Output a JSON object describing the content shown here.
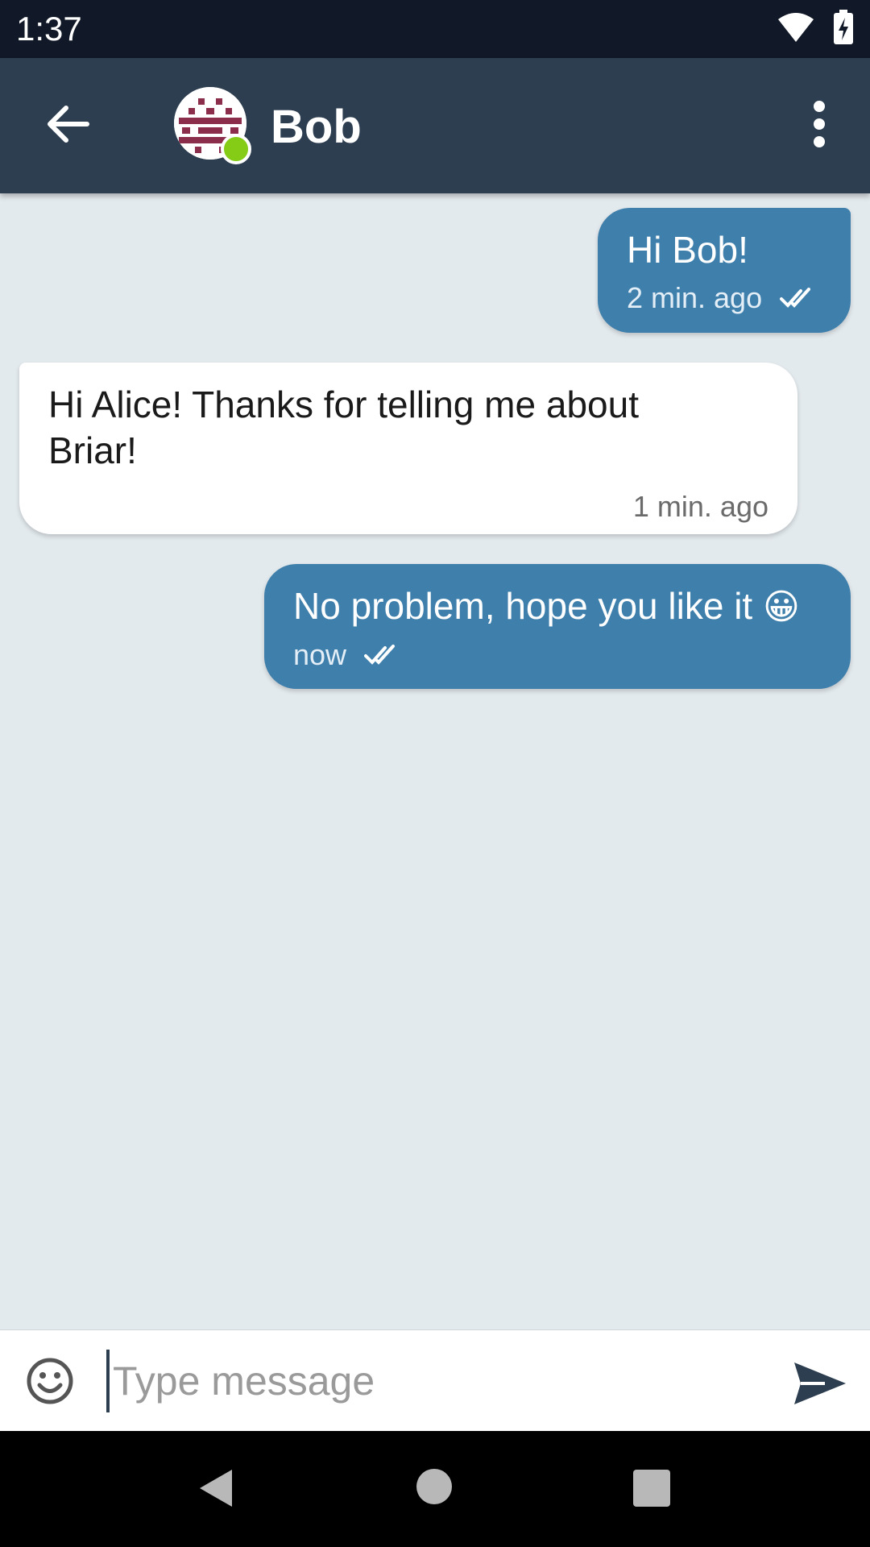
{
  "status_bar": {
    "time": "1:37",
    "icons": [
      "wifi-icon",
      "battery-charging-icon"
    ]
  },
  "toolbar": {
    "contact_name": "Bob",
    "online": true,
    "icons": [
      "back-arrow-icon",
      "identicon-avatar",
      "more-vert-icon"
    ]
  },
  "messages": [
    {
      "direction": "outgoing",
      "text": "Hi Bob!",
      "time": "2 min. ago",
      "status_icon": "double-check-icon"
    },
    {
      "direction": "incoming",
      "text": "Hi Alice! Thanks for telling me about Briar!",
      "time": "1 min. ago"
    },
    {
      "direction": "outgoing",
      "text": "No problem, hope you like it",
      "emoji": "😀",
      "time": "now",
      "status_icon": "double-check-icon"
    }
  ],
  "composer": {
    "placeholder": "Type message",
    "icons": [
      "emoji-icon",
      "send-icon"
    ]
  },
  "colors": {
    "toolbar": "#2d3e50",
    "outgoing_bubble": "#3f7fac",
    "incoming_bubble": "#ffffff",
    "background": "#e3eaee",
    "online": "#84cc16"
  }
}
